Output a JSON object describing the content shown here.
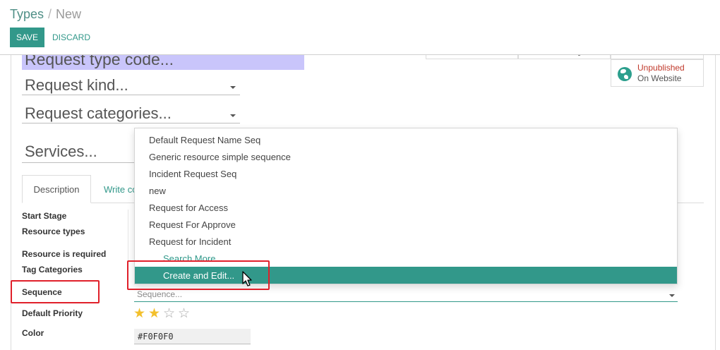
{
  "breadcrumb": {
    "parent": "Types",
    "separator": "/",
    "current": "New"
  },
  "toolbar": {
    "save_label": "SAVE",
    "discard_label": "DISCARD"
  },
  "form": {
    "code_placeholder": "Request type code...",
    "kind_placeholder": "Request kind...",
    "categories_placeholder": "Request categories...",
    "services_placeholder": "Services...",
    "website": {
      "status": "Unpublished",
      "sub": "On Website",
      "status_color": "#c0392b"
    },
    "tabs": [
      {
        "label": "Description"
      },
      {
        "label": "Write co"
      }
    ],
    "labels": {
      "start_stage": "Start Stage",
      "resource_types": "Resource types",
      "resource_required": "Resource is required",
      "tag_categories": "Tag Categories",
      "sequence": "Sequence",
      "default_priority": "Default Priority",
      "color": "Color"
    },
    "sequence_placeholder": "Sequence...",
    "priority_stars": {
      "filled": 2,
      "total": 4
    },
    "color_value": "#F0F0F0"
  },
  "dropdown": {
    "items": [
      "Default Request Name Seq",
      "Generic resource simple sequence",
      "Incident Request Seq",
      "new",
      "Request for Access",
      "Request For Approve",
      "Request for Incident"
    ],
    "search_more": "Search More...",
    "create_edit": "Create and Edit..."
  },
  "colors": {
    "accent": "#32988a",
    "code_field_bg": "#c9c5fb",
    "annotation": "#e0202a",
    "star": "#f3c02c"
  }
}
